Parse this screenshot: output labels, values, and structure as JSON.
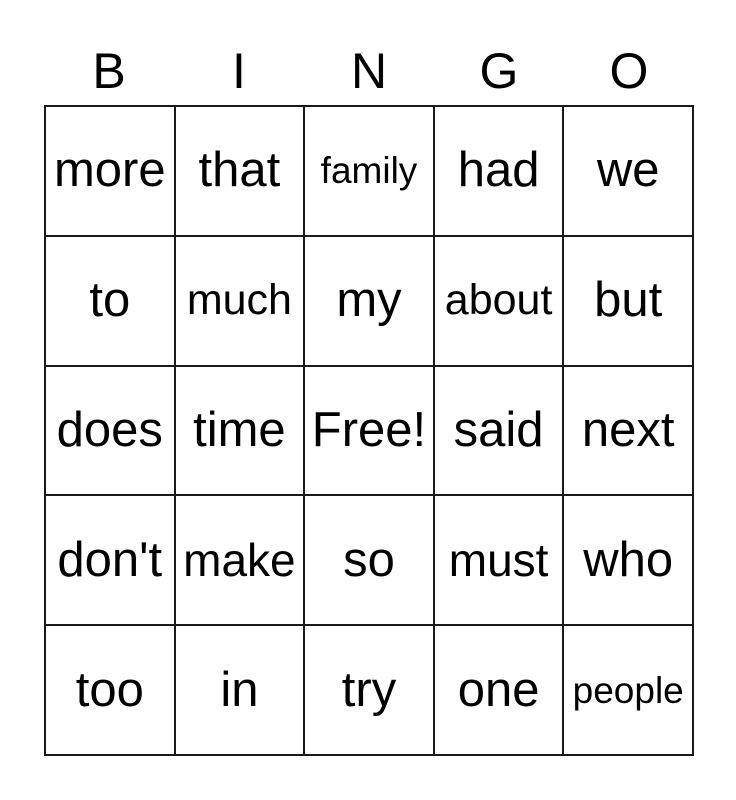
{
  "card": {
    "title": "BINGO",
    "header_letters": [
      "B",
      "I",
      "N",
      "G",
      "O"
    ],
    "grid_size": "5x5",
    "free_space": "Free!",
    "rows": [
      [
        {
          "text": "more",
          "size": "xl"
        },
        {
          "text": "that",
          "size": "xl"
        },
        {
          "text": "family",
          "size": "sm"
        },
        {
          "text": "had",
          "size": "xl"
        },
        {
          "text": "we",
          "size": "xl"
        }
      ],
      [
        {
          "text": "to",
          "size": "xl"
        },
        {
          "text": "much",
          "size": "md"
        },
        {
          "text": "my",
          "size": "xl"
        },
        {
          "text": "about",
          "size": "md"
        },
        {
          "text": "but",
          "size": "xl"
        }
      ],
      [
        {
          "text": "does",
          "size": "xl"
        },
        {
          "text": "time",
          "size": "xl"
        },
        {
          "text": "Free!",
          "size": "xl"
        },
        {
          "text": "said",
          "size": "xl"
        },
        {
          "text": "next",
          "size": "xl"
        }
      ],
      [
        {
          "text": "don't",
          "size": "xl"
        },
        {
          "text": "make",
          "size": "lg"
        },
        {
          "text": "so",
          "size": "xl"
        },
        {
          "text": "must",
          "size": "lg"
        },
        {
          "text": "who",
          "size": "xl"
        }
      ],
      [
        {
          "text": "too",
          "size": "xl"
        },
        {
          "text": "in",
          "size": "xl"
        },
        {
          "text": "try",
          "size": "xl"
        },
        {
          "text": "one",
          "size": "xl"
        },
        {
          "text": "people",
          "size": "sm"
        }
      ]
    ]
  },
  "colors": {
    "background": "#ffffff",
    "text": "#000000",
    "grid_line": "#1a1a1a"
  }
}
